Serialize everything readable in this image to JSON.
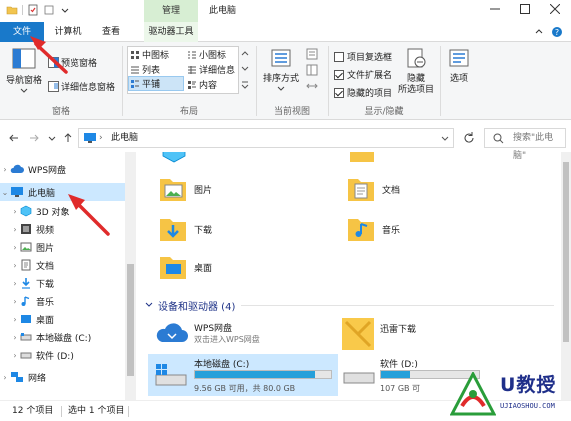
{
  "window": {
    "context_tab": "管理",
    "title": "此电脑",
    "controls": [
      "minimize",
      "maximize",
      "close"
    ]
  },
  "ribbon_tabs": {
    "file": "文件",
    "computer": "计算机",
    "view": "查看",
    "drive_tools": "驱动器工具"
  },
  "ribbon": {
    "panes": {
      "label": "窗格",
      "nav_pane": "导航窗格",
      "preview_pane": "预览窗格",
      "details_pane": "详细信息窗格"
    },
    "layout": {
      "label": "布局",
      "items": [
        "中图标",
        "小图标",
        "列表",
        "详细信息",
        "平铺",
        "内容"
      ],
      "selected": "平铺"
    },
    "current_view": {
      "label": "当前视图",
      "sort_by": "排序方式"
    },
    "show_hide": {
      "label": "显示/隐藏",
      "item_checkboxes": "项目复选框",
      "file_extensions": "文件扩展名",
      "hidden_items": "隐藏的项目",
      "hide_selected": "隐藏",
      "hide_selected_line2": "所选项目",
      "checked": {
        "item_checkboxes": false,
        "file_extensions": true,
        "hidden_items": true
      }
    },
    "options": "选项"
  },
  "address": {
    "path": "此电脑",
    "search_placeholder": "搜索\"此电脑\""
  },
  "nav_pane": {
    "wps": "WPS网盘",
    "this_pc": "此电脑",
    "children": [
      "3D 对象",
      "视频",
      "图片",
      "文档",
      "下载",
      "音乐",
      "桌面",
      "本地磁盘 (C:)",
      "软件 (D:)"
    ],
    "network": "网络"
  },
  "folders": {
    "pictures": "图片",
    "documents": "文档",
    "downloads": "下载",
    "music": "音乐",
    "desktop": "桌面"
  },
  "devices": {
    "header": "设备和驱动器 (4)",
    "wps_name": "WPS网盘",
    "wps_sub": "双击进入WPS网盘",
    "xunlei": "迅雷下载",
    "c_name": "本地磁盘 (C:)",
    "c_space": "9.56 GB 可用，共 80.0 GB",
    "c_used_fraction": 0.88,
    "d_name": "软件 (D:)",
    "d_space": "107 GB 可",
    "d_used_fraction": 0.3
  },
  "status": {
    "count": "12 个项目",
    "selected": "选中 1 个项目"
  },
  "watermark": {
    "main": "U教授",
    "url": "UJIAOSHOU.COM"
  },
  "colors": {
    "accent": "#1979ca",
    "context_tab": "#d7eed3",
    "selection": "#cce8ff",
    "bar_fill": "#26a0da",
    "annotation": "#e02b2b"
  }
}
